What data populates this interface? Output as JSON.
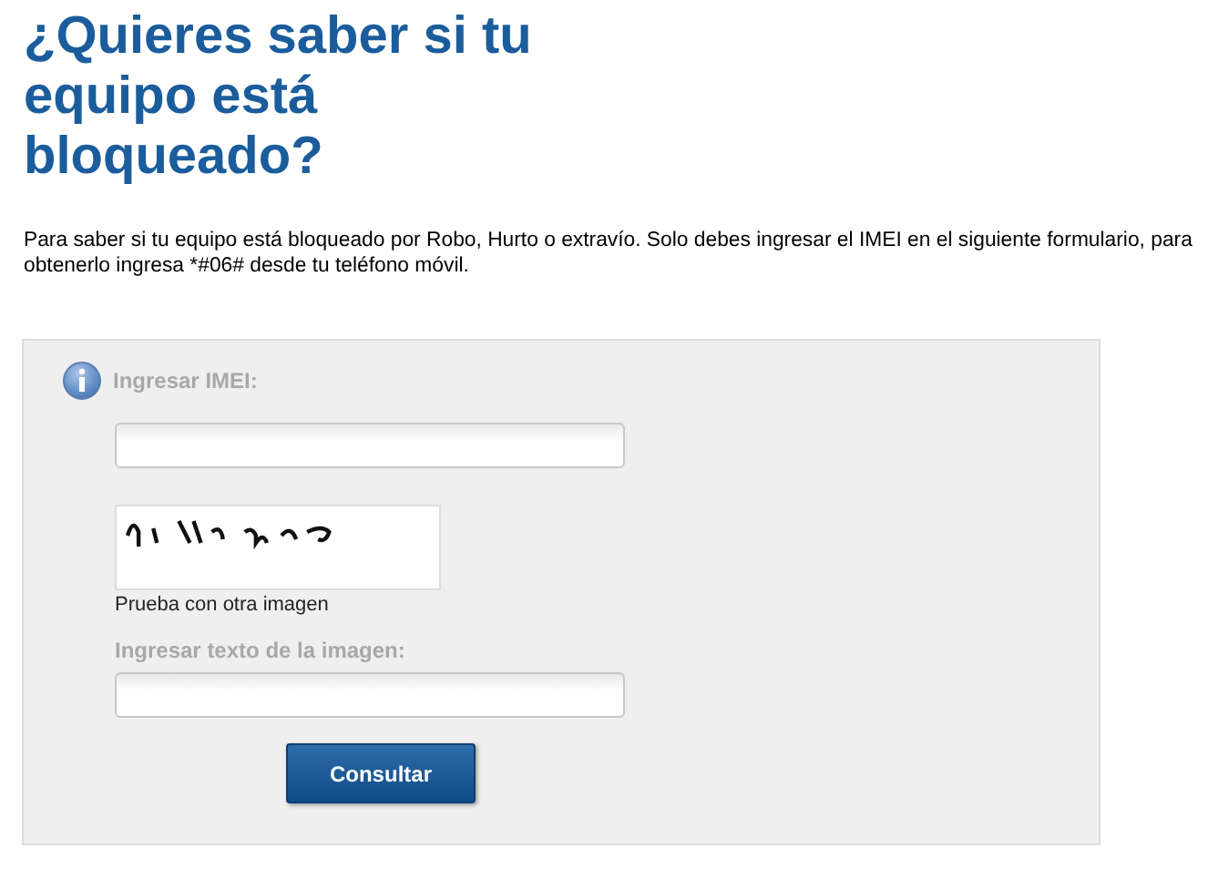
{
  "heading": "¿Quieres saber si tu equipo está bloqueado?",
  "intro": "Para saber si tu equipo está bloqueado por Robo, Hurto o extravío. Solo debes ingresar el IMEI en el siguiente formulario, para obtenerlo ingresa *#06# desde tu teléfono móvil.",
  "form": {
    "imei_label": "Ingresar IMEI:",
    "refresh_link": "Prueba con otra imagen",
    "captcha_label": "Ingresar texto de la imagen:",
    "submit": "Consultar"
  }
}
